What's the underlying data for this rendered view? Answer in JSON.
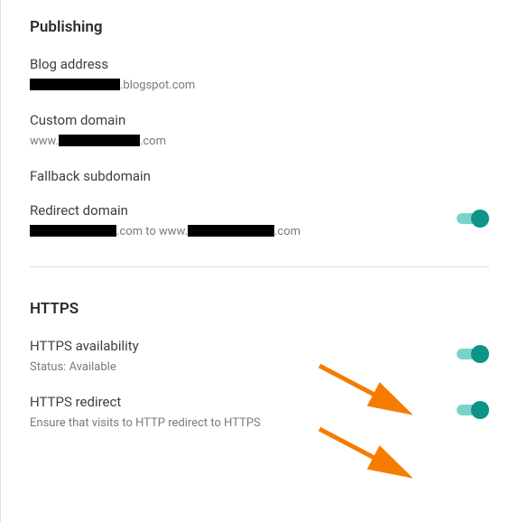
{
  "publishing": {
    "title": "Publishing",
    "blog_address": {
      "label": "Blog address",
      "domain_suffix": ".blogspot.com"
    },
    "custom_domain": {
      "label": "Custom domain",
      "prefix": "www.",
      "suffix": ".com"
    },
    "fallback_subdomain": {
      "label": "Fallback subdomain"
    },
    "redirect_domain": {
      "label": "Redirect domain",
      "suffix1": ".com to www.",
      "suffix2": ".com"
    }
  },
  "https": {
    "title": "HTTPS",
    "availability": {
      "label": "HTTPS availability",
      "status": "Status: Available"
    },
    "redirect": {
      "label": "HTTPS redirect",
      "description": "Ensure that visits to HTTP redirect to HTTPS"
    }
  },
  "colors": {
    "toggle_on": "#0d9488",
    "toggle_track": "#79d3c9",
    "arrow": "#f57c00"
  }
}
